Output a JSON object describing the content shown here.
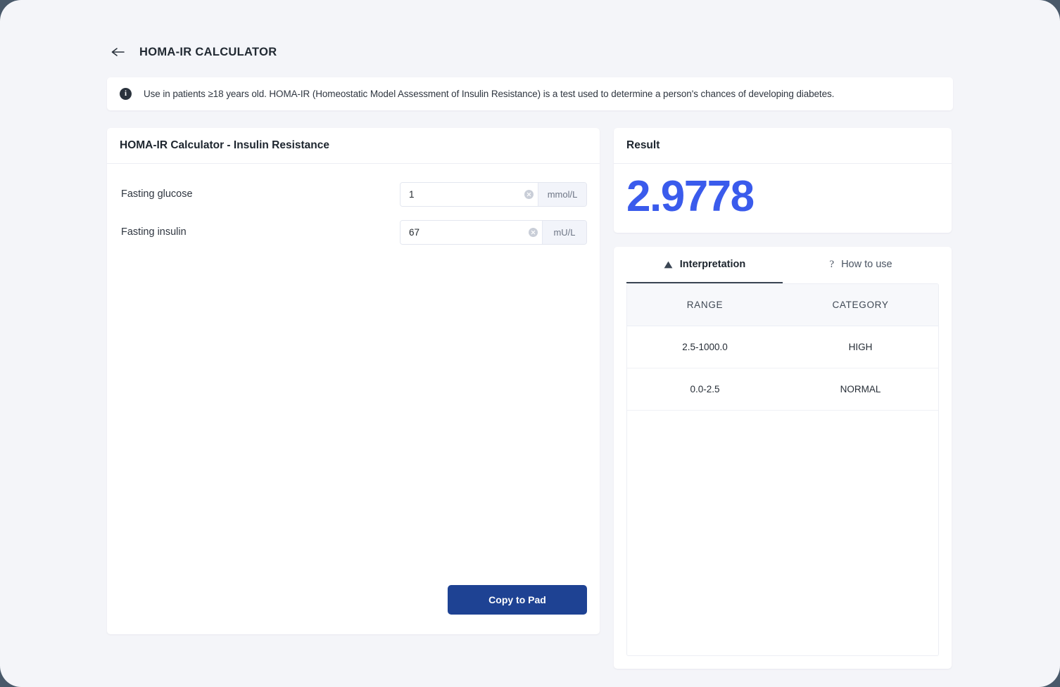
{
  "header": {
    "back_icon": "arrow-left-icon",
    "title": "HOMA-IR CALCULATOR"
  },
  "banner": {
    "icon": "info-icon",
    "icon_glyph": "i",
    "text": "Use in patients ≥18 years old. HOMA-IR (Homeostatic Model Assessment of Insulin Resistance) is a test used to determine a person's chances of developing diabetes."
  },
  "calculator": {
    "title": "HOMA-IR Calculator - Insulin Resistance",
    "fields": [
      {
        "label": "Fasting glucose",
        "value": "1",
        "placeholder": "",
        "unit": "mmol/L",
        "clear_icon": "clear-circle-icon"
      },
      {
        "label": "Fasting insulin",
        "value": "67",
        "placeholder": "",
        "unit": "mU/L",
        "clear_icon": "clear-circle-icon"
      }
    ],
    "copy_button": "Copy to Pad"
  },
  "result": {
    "title": "Result",
    "value": "2.9778",
    "color": "#3a5bec"
  },
  "tabs": [
    {
      "label": "Interpretation",
      "icon": "warning-triangle-icon",
      "active": true
    },
    {
      "label": "How to use",
      "icon": "question-mark-icon",
      "active": false
    }
  ],
  "interpretation_table": {
    "columns": [
      "RANGE",
      "CATEGORY"
    ],
    "rows": [
      {
        "range": "2.5-1000.0",
        "category": "HIGH"
      },
      {
        "range": "0.0-2.5",
        "category": "NORMAL"
      }
    ]
  }
}
